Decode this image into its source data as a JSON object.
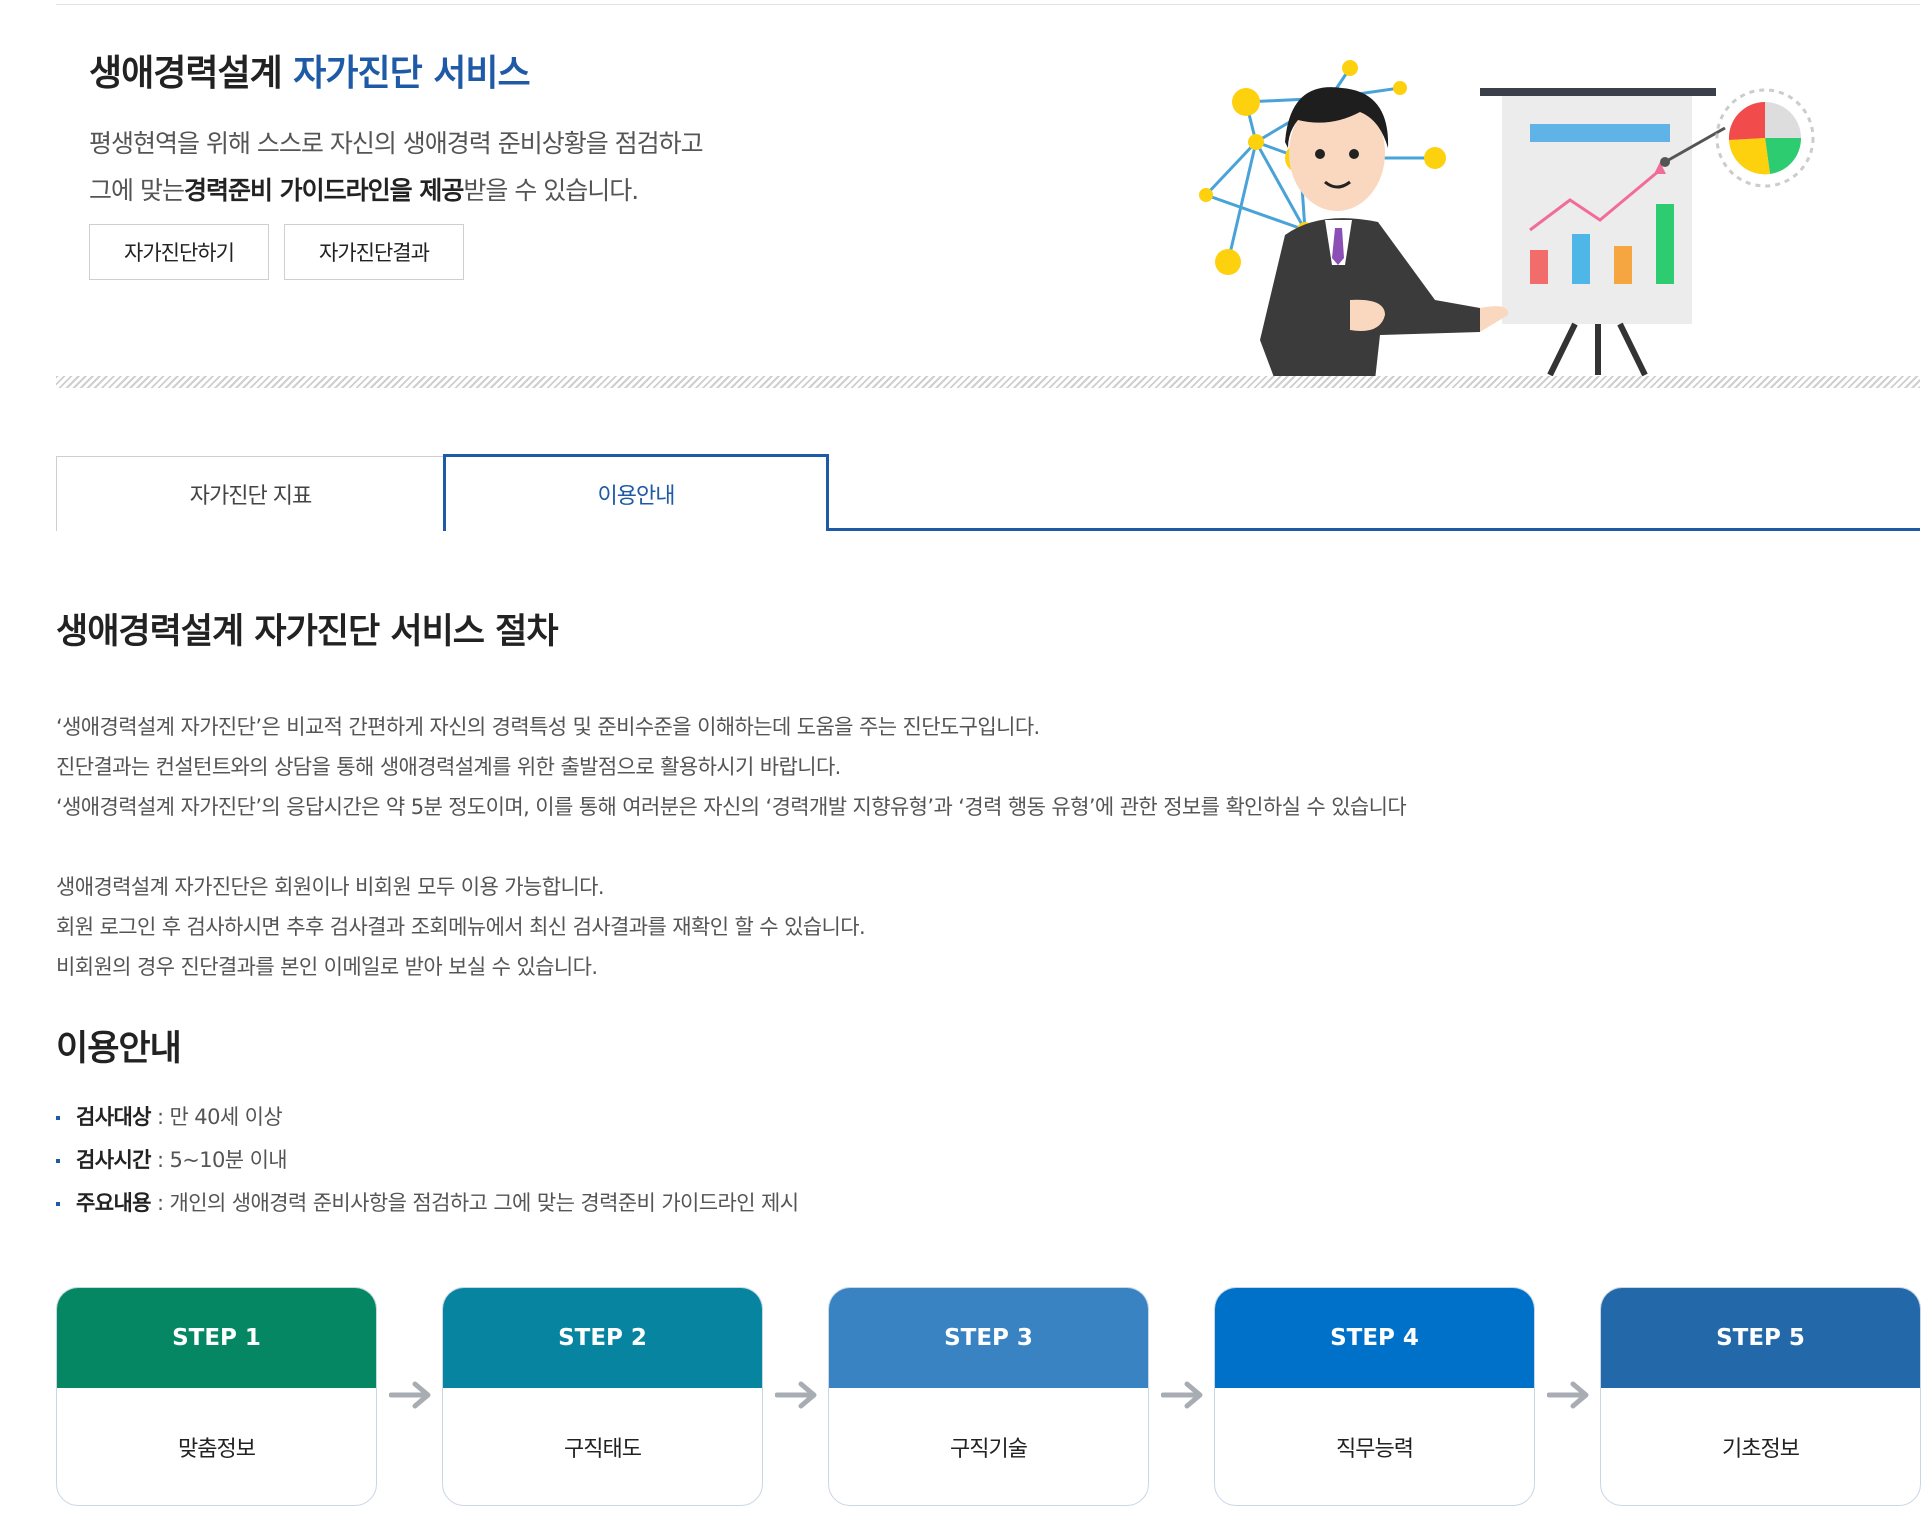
{
  "hero": {
    "title_main": "생애경력설계",
    "title_accent": "자가진단 서비스",
    "desc_line1": "평생현역을 위해 스스로 자신의 생애경력 준비상황을 점검하고",
    "desc_line2_a": "그에 맞는",
    "desc_line2_b": "경력준비 가이드라인을 제공",
    "desc_line2_c": "받을 수 있습니다.",
    "btn_start": "자가진단하기",
    "btn_result": "자가진단결과"
  },
  "tabs": {
    "index": "자가진단 지표",
    "guide": "이용안내"
  },
  "procedure": {
    "heading": "생애경력설계 자가진단 서비스 절차",
    "para1": [
      "‘생애경력설계 자가진단’은 비교적 간편하게 자신의 경력특성 및 준비수준을 이해하는데 도움을 주는 진단도구입니다.",
      "진단결과는 컨설턴트와의 상담을 통해 생애경력설계를 위한 출발점으로 활용하시기 바랍니다.",
      "‘생애경력설계 자가진단’의 응답시간은 약 5분 정도이며, 이를 통해 여러분은 자신의 ‘경력개발 지향유형’과 ‘경력 행동 유형’에 관한 정보를 확인하실 수 있습니다"
    ],
    "para2": [
      "생애경력설계 자가진단은 회원이나 비회원 모두 이용 가능합니다.",
      "회원 로그인 후 검사하시면 추후 검사결과 조회메뉴에서 최신 검사결과를 재확인 할 수 있습니다.",
      "비회원의 경우 진단결과를 본인 이메일로 받아 보실 수 있습니다."
    ]
  },
  "guide": {
    "heading": "이용안내",
    "items": [
      {
        "label": "검사대상",
        "value": " : 만 40세 이상"
      },
      {
        "label": "검사시간",
        "value": " : 5~10분 이내"
      },
      {
        "label": "주요내용",
        "value": " : 개인의 생애경력 준비사항을 점검하고 그에 맞는 경력준비 가이드라인 제시"
      }
    ]
  },
  "steps": [
    {
      "step": "STEP 1",
      "name": "맞춤정보",
      "color": "#058763"
    },
    {
      "step": "STEP 2",
      "name": "구직태도",
      "color": "#07849f"
    },
    {
      "step": "STEP 3",
      "name": "구직기술",
      "color": "#3983c3"
    },
    {
      "step": "STEP 4",
      "name": "직무능력",
      "color": "#0071c8"
    },
    {
      "step": "STEP 5",
      "name": "기초정보",
      "color": "#2368a8"
    }
  ],
  "colors": {
    "accent": "#1f5aa6"
  }
}
